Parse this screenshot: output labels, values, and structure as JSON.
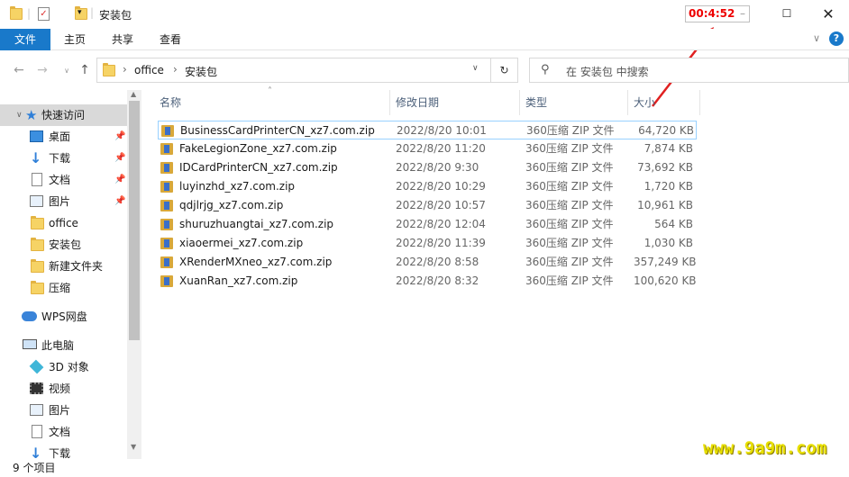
{
  "window": {
    "title": "安装包",
    "timer": "00:4:52"
  },
  "ribbon": {
    "tabs": [
      "文件",
      "主页",
      "共享",
      "查看"
    ]
  },
  "address": {
    "path": [
      "office",
      "安装包"
    ],
    "search_placeholder": "在 安装包 中搜索"
  },
  "sidebar": {
    "items": [
      {
        "label": "快速访问",
        "icon": "star-icon"
      },
      {
        "label": "桌面",
        "icon": "desktop-icon",
        "pinned": true
      },
      {
        "label": "下载",
        "icon": "download-icon",
        "pinned": true
      },
      {
        "label": "文档",
        "icon": "document-icon",
        "pinned": true
      },
      {
        "label": "图片",
        "icon": "picture-icon",
        "pinned": true
      },
      {
        "label": "office",
        "icon": "folder-icon"
      },
      {
        "label": "安装包",
        "icon": "folder-icon"
      },
      {
        "label": "新建文件夹",
        "icon": "folder-icon"
      },
      {
        "label": "压缩",
        "icon": "folder-icon"
      },
      {
        "label": "WPS网盘",
        "icon": "cloud-icon"
      },
      {
        "label": "此电脑",
        "icon": "computer-icon"
      },
      {
        "label": "3D 对象",
        "icon": "3d-icon"
      },
      {
        "label": "视频",
        "icon": "video-icon"
      },
      {
        "label": "图片",
        "icon": "picture-icon"
      },
      {
        "label": "文档",
        "icon": "document-icon"
      },
      {
        "label": "下载",
        "icon": "download-icon"
      }
    ]
  },
  "table": {
    "headers": [
      "名称",
      "修改日期",
      "类型",
      "大小"
    ],
    "rows": [
      {
        "name": "BusinessCardPrinterCN_xz7.com.zip",
        "date": "2022/8/20 10:01",
        "type": "360压缩 ZIP 文件",
        "size": "64,720 KB"
      },
      {
        "name": "FakeLegionZone_xz7.com.zip",
        "date": "2022/8/20 11:20",
        "type": "360压缩 ZIP 文件",
        "size": "7,874 KB"
      },
      {
        "name": "IDCardPrinterCN_xz7.com.zip",
        "date": "2022/8/20 9:30",
        "type": "360压缩 ZIP 文件",
        "size": "73,692 KB"
      },
      {
        "name": "luyinzhd_xz7.com.zip",
        "date": "2022/8/20 10:29",
        "type": "360压缩 ZIP 文件",
        "size": "1,720 KB"
      },
      {
        "name": "qdjlrjg_xz7.com.zip",
        "date": "2022/8/20 10:57",
        "type": "360压缩 ZIP 文件",
        "size": "10,961 KB"
      },
      {
        "name": "shuruzhuangtai_xz7.com.zip",
        "date": "2022/8/20 12:04",
        "type": "360压缩 ZIP 文件",
        "size": "564 KB"
      },
      {
        "name": "xiaoermei_xz7.com.zip",
        "date": "2022/8/20 11:39",
        "type": "360压缩 ZIP 文件",
        "size": "1,030 KB"
      },
      {
        "name": "XRenderMXneo_xz7.com.zip",
        "date": "2022/8/20 8:58",
        "type": "360压缩 ZIP 文件",
        "size": "357,249 KB"
      },
      {
        "name": "XuanRan_xz7.com.zip",
        "date": "2022/8/20 8:32",
        "type": "360压缩 ZIP 文件",
        "size": "100,620 KB"
      }
    ]
  },
  "status": {
    "count": "9 个项目"
  },
  "watermark": "www.9a9m.com",
  "colors": {
    "accent": "#1979ca",
    "selection": "#cce8ff",
    "timer": "#e00000",
    "watermark": "#e8e000"
  }
}
